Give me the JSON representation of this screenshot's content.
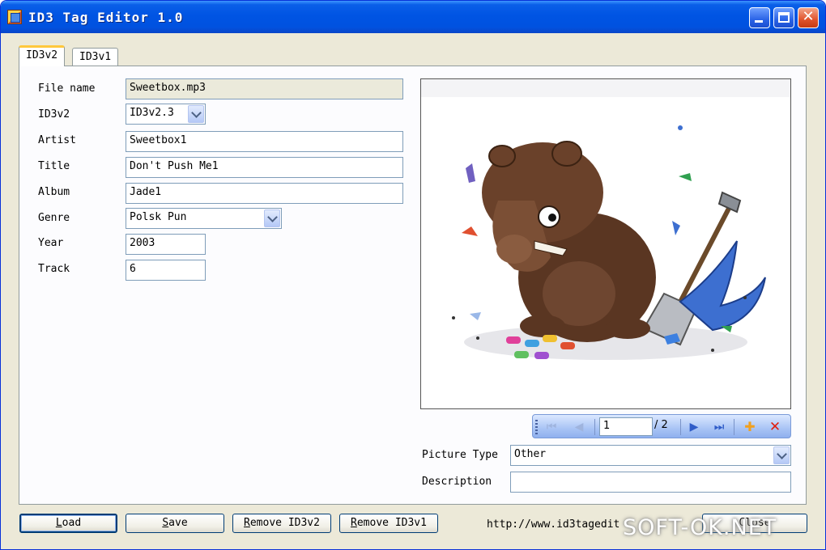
{
  "window": {
    "title": "ID3 Tag Editor 1.0",
    "minimize_icon": "minimize-icon",
    "maximize_icon": "maximize-icon",
    "close_glyph": "✕"
  },
  "tabs": [
    {
      "label": "ID3v2",
      "active": true
    },
    {
      "label": "ID3v1",
      "active": false
    }
  ],
  "form": {
    "file_name": {
      "label": "File name",
      "value": "Sweetbox.mp3"
    },
    "id3v2": {
      "label": "ID3v2",
      "value": "ID3v2.3"
    },
    "artist": {
      "label": "Artist",
      "value": "Sweetbox1"
    },
    "title": {
      "label": "Title",
      "value": "Don't Push Me1"
    },
    "album": {
      "label": "Album",
      "value": "Jade1"
    },
    "genre": {
      "label": "Genre",
      "value": "Polsk Pun"
    },
    "year": {
      "label": "Year",
      "value": "2003"
    },
    "track": {
      "label": "Track",
      "value": "6"
    }
  },
  "picture": {
    "description": "cartoon-tapir-artwork",
    "navigator": {
      "current": "1",
      "total": "/ 2",
      "first_icon": "⏮",
      "prev_icon": "◀",
      "next_icon": "▶",
      "last_icon": "⏭",
      "add_icon": "✚",
      "delete_icon": "✕"
    },
    "picture_type": {
      "label": "Picture Type",
      "value": "Other"
    },
    "description_field": {
      "label": "Description",
      "value": ""
    }
  },
  "buttons": {
    "load": {
      "mnemonic": "L",
      "rest": "oad"
    },
    "save": {
      "mnemonic": "S",
      "rest": "ave"
    },
    "remove_v2": {
      "mnemonic": "R",
      "rest": "emove ID3v2"
    },
    "remove_v1": {
      "mnemonic": "R",
      "rest": "emove ID3v1"
    },
    "close": {
      "label": "Close"
    }
  },
  "footer": {
    "url": "http://www.id3tagedit",
    "watermark": "SOFT-OK.NET"
  },
  "colors": {
    "titlebar": "#0054e3",
    "dialog_bg": "#ece9d8",
    "tab_highlight": "#ffc83c",
    "close_red": "#e0532c",
    "nav_blue": "#2f5cc8"
  }
}
